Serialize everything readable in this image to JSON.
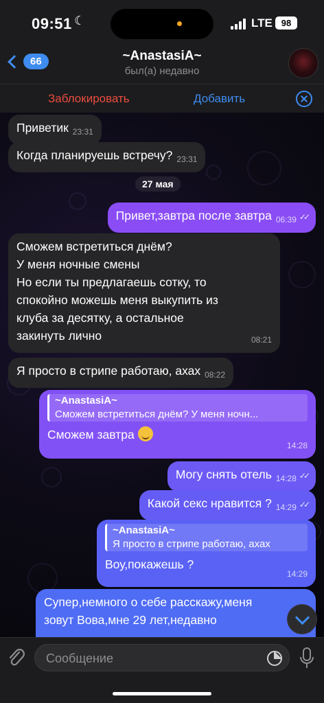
{
  "status_bar": {
    "time": "09:51",
    "network": "LTE",
    "battery": "98"
  },
  "header": {
    "back_count": "66",
    "title": "~AnastasiA~",
    "subtitle": "был(а) недавно"
  },
  "action_bar": {
    "block_label": "Заблокировать",
    "add_label": "Добавить"
  },
  "date_separator": "27 мая",
  "messages": [
    {
      "text": "Приветик",
      "time": "23:31"
    },
    {
      "text": "Когда планируешь встречу?",
      "time": "23:31"
    },
    {
      "text": "Привет,завтра после завтра",
      "time": "06:39"
    },
    {
      "lines": [
        "Сможем встретиться днём?",
        "У меня ночные смены",
        "Но если ты предлагаешь сотку, то",
        "спокойно можешь меня выкупить из",
        "клуба за десятку, а остальное",
        "закинуть лично"
      ],
      "time": "08:21"
    },
    {
      "text": "Я просто в стрипе работаю, ахах",
      "time": "08:22"
    },
    {
      "reply_name": "~AnastasiA~",
      "reply_text": "Сможем встретиться днём? У меня ночн...",
      "text": "Сможем завтра",
      "time": "14:28"
    },
    {
      "text": "Могу снять отель",
      "time": "14:28"
    },
    {
      "text": "Какой секс нравится ?",
      "time": "14:29"
    },
    {
      "reply_name": "~AnastasiA~",
      "reply_text": "Я просто в стрипе работаю, ахах",
      "text": "Воу,покажешь ?",
      "time": "14:29"
    },
    {
      "lines": [
        "Супер,немного о себе расскажу,меня",
        "зовут Вова,мне 29 лет,недавно"
      ]
    }
  ],
  "input": {
    "placeholder": "Сообщение"
  },
  "colors": {
    "accent": "#3e8cf0",
    "danger": "#eb4d3d",
    "outgoing_top": "#8a4df5",
    "outgoing_bottom": "#4f6cf5"
  }
}
